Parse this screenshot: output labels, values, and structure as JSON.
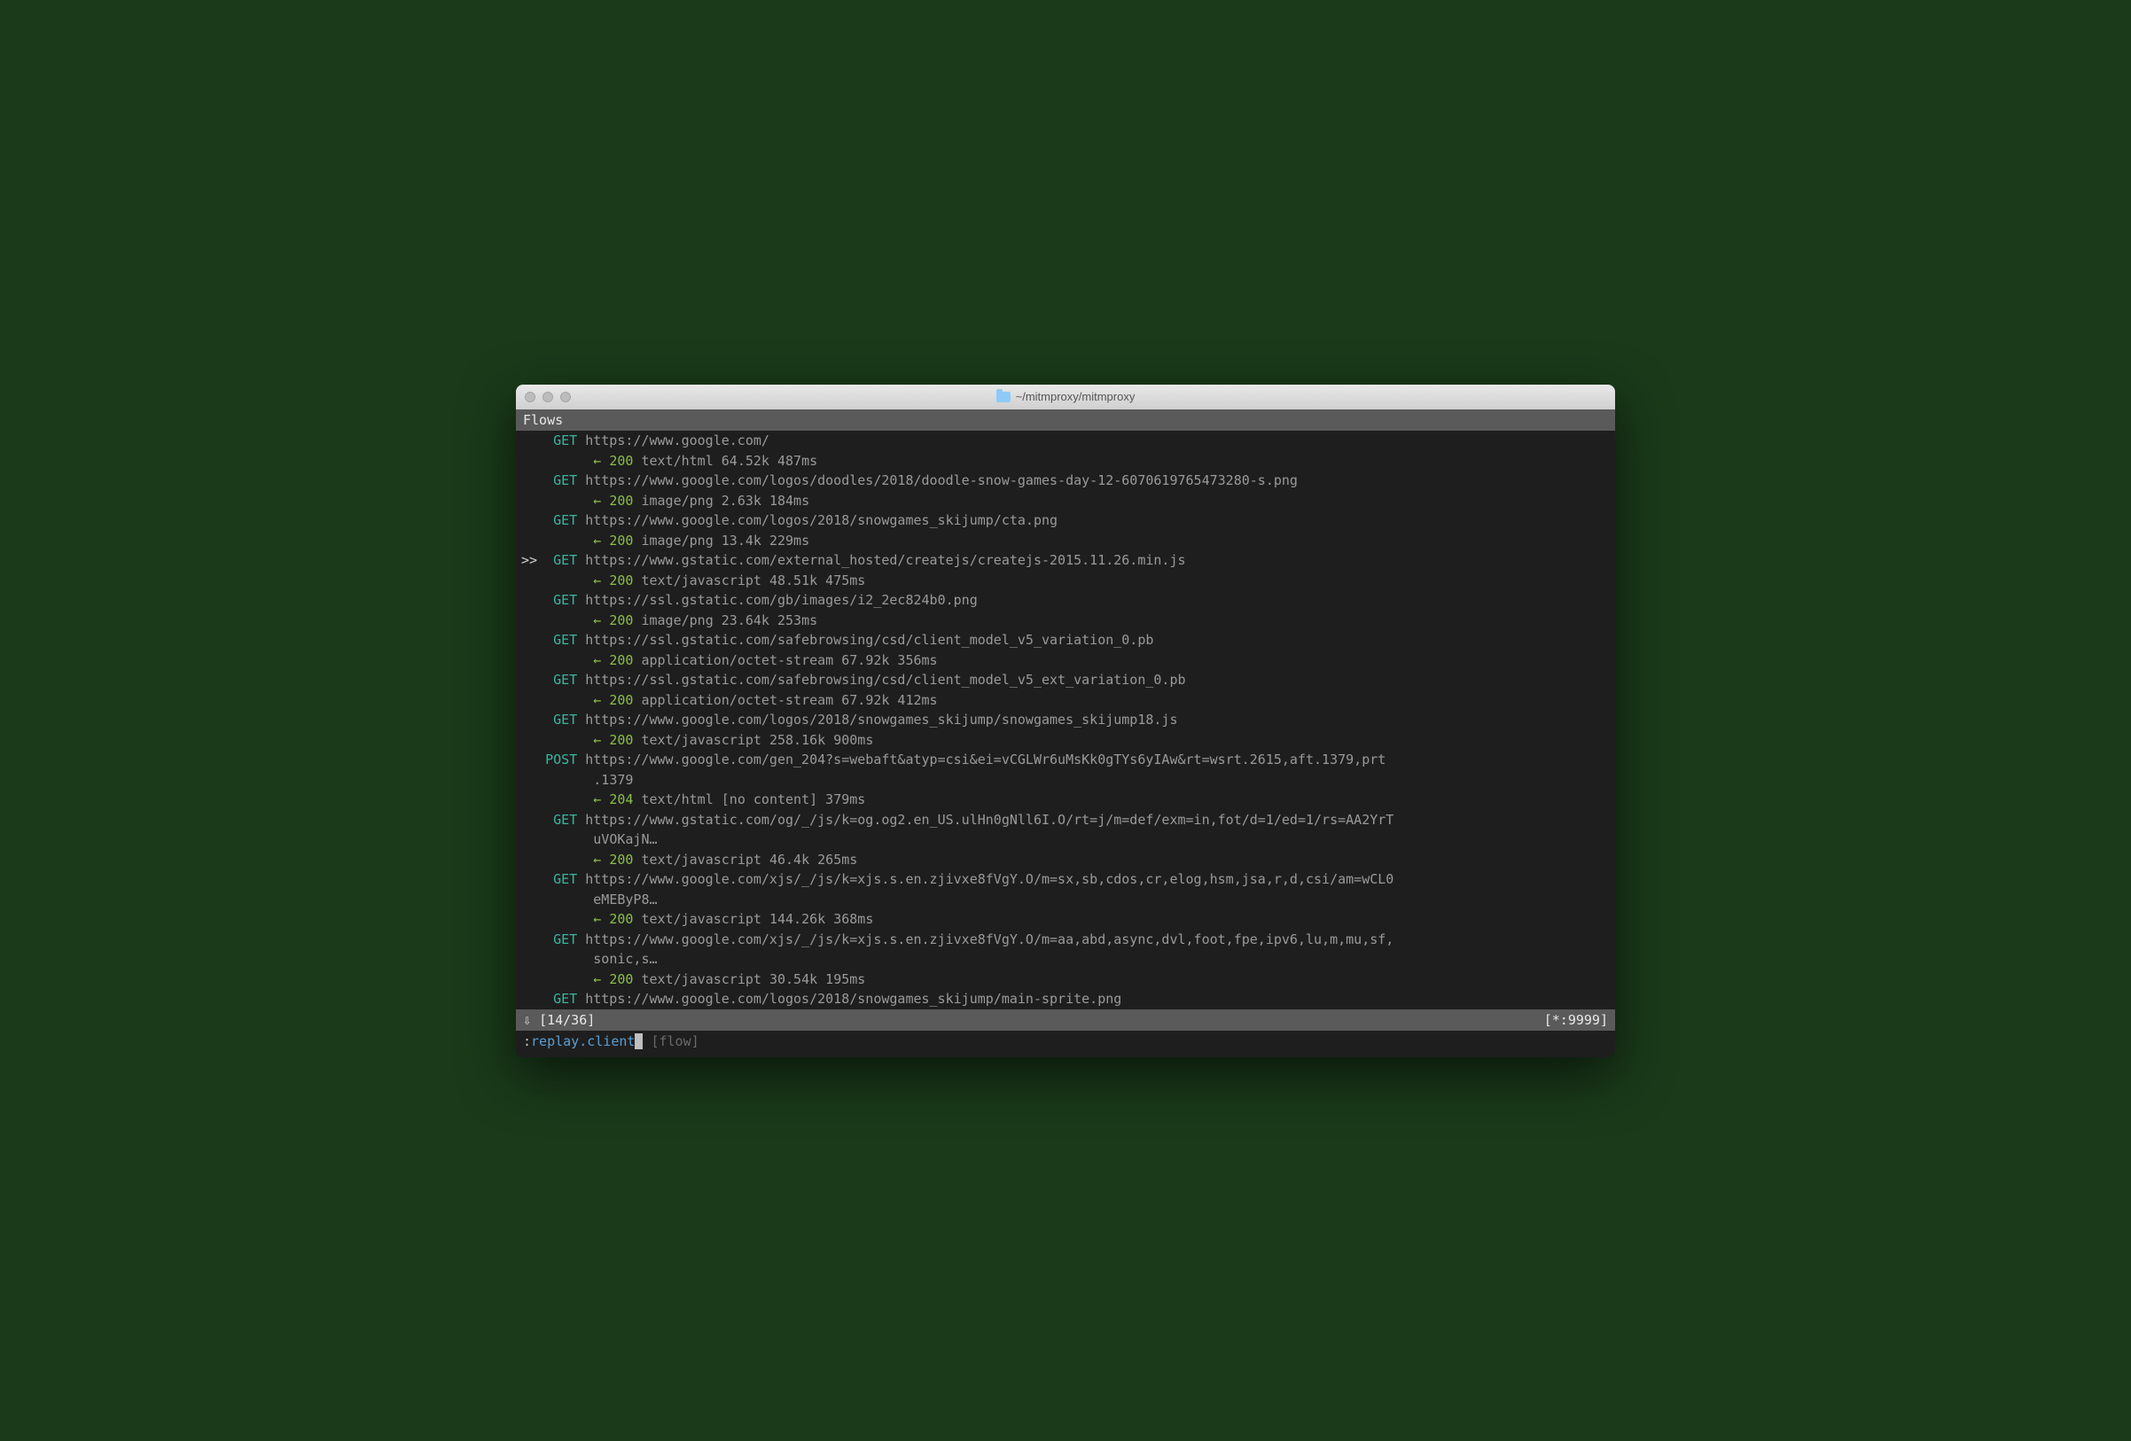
{
  "titlebar": {
    "path": "~/mitmproxy/mitmproxy"
  },
  "header": {
    "label": "Flows"
  },
  "flows": [
    {
      "marker": "",
      "method": "GET",
      "url": "https://www.google.com/",
      "respArrow": "←",
      "status": "200",
      "respMeta": "text/html 64.52k 487ms"
    },
    {
      "marker": "",
      "method": "GET",
      "url": "https://www.google.com/logos/doodles/2018/doodle-snow-games-day-12-6070619765473280-s.png",
      "respArrow": "←",
      "status": "200",
      "respMeta": "image/png 2.63k 184ms"
    },
    {
      "marker": "",
      "method": "GET",
      "url": "https://www.google.com/logos/2018/snowgames_skijump/cta.png",
      "respArrow": "←",
      "status": "200",
      "respMeta": "image/png 13.4k 229ms"
    },
    {
      "marker": ">>",
      "method": "GET",
      "url": "https://www.gstatic.com/external_hosted/createjs/createjs-2015.11.26.min.js",
      "respArrow": "←",
      "status": "200",
      "respMeta": "text/javascript 48.51k 475ms"
    },
    {
      "marker": "",
      "method": "GET",
      "url": "https://ssl.gstatic.com/gb/images/i2_2ec824b0.png",
      "respArrow": "←",
      "status": "200",
      "respMeta": "image/png 23.64k 253ms"
    },
    {
      "marker": "",
      "method": "GET",
      "url": "https://ssl.gstatic.com/safebrowsing/csd/client_model_v5_variation_0.pb",
      "respArrow": "←",
      "status": "200",
      "respMeta": "application/octet-stream 67.92k 356ms"
    },
    {
      "marker": "",
      "method": "GET",
      "url": "https://ssl.gstatic.com/safebrowsing/csd/client_model_v5_ext_variation_0.pb",
      "respArrow": "←",
      "status": "200",
      "respMeta": "application/octet-stream 67.92k 412ms"
    },
    {
      "marker": "",
      "method": "GET",
      "url": "https://www.google.com/logos/2018/snowgames_skijump/snowgames_skijump18.js",
      "respArrow": "←",
      "status": "200",
      "respMeta": "text/javascript 258.16k 900ms"
    },
    {
      "marker": "",
      "method": "POST",
      "url": "https://www.google.com/gen_204?s=webaft&atyp=csi&ei=vCGLWr6uMsKk0gTYs6yIAw&rt=wsrt.2615,aft.1379,prt",
      "urlCont": ".1379",
      "respArrow": "←",
      "status": "204",
      "respMeta": "text/html [no content] 379ms"
    },
    {
      "marker": "",
      "method": "GET",
      "url": "https://www.gstatic.com/og/_/js/k=og.og2.en_US.ulHn0gNll6I.O/rt=j/m=def/exm=in,fot/d=1/ed=1/rs=AA2YrT",
      "urlCont": "uVOKajN…",
      "respArrow": "←",
      "status": "200",
      "respMeta": "text/javascript 46.4k 265ms"
    },
    {
      "marker": "",
      "method": "GET",
      "url": "https://www.google.com/xjs/_/js/k=xjs.s.en.zjivxe8fVgY.O/m=sx,sb,cdos,cr,elog,hsm,jsa,r,d,csi/am=wCL0",
      "urlCont": "eMEByP8…",
      "respArrow": "←",
      "status": "200",
      "respMeta": "text/javascript 144.26k 368ms"
    },
    {
      "marker": "",
      "method": "GET",
      "url": "https://www.google.com/xjs/_/js/k=xjs.s.en.zjivxe8fVgY.O/m=aa,abd,async,dvl,foot,fpe,ipv6,lu,m,mu,sf,",
      "urlCont": "sonic,s…",
      "respArrow": "←",
      "status": "200",
      "respMeta": "text/javascript 30.54k 195ms"
    },
    {
      "marker": "",
      "method": "GET",
      "url": "https://www.google.com/logos/2018/snowgames_skijump/main-sprite.png",
      "respArrow": "",
      "status": "",
      "respMeta": ""
    }
  ],
  "footer": {
    "scrollIcon": "⇩",
    "position": "[14/36]",
    "listen": "[*:9999]"
  },
  "command": {
    "prompt": ": ",
    "text": "replay.client",
    "hint": "[flow]"
  }
}
